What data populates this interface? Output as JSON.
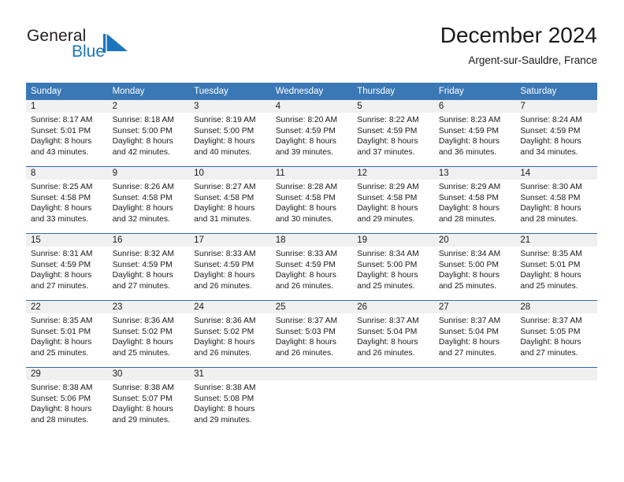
{
  "brand": {
    "name_part1": "General",
    "name_part2": "Blue",
    "flag_color": "#1b75bb"
  },
  "header": {
    "title": "December 2024",
    "subtitle": "Argent-sur-Sauldre, France"
  },
  "theme": {
    "header_blue": "#3a78b5",
    "rule_blue": "#2f6daf",
    "daynum_band": "#f0f0f0",
    "text": "#1a1a1a"
  },
  "weekdays": [
    "Sunday",
    "Monday",
    "Tuesday",
    "Wednesday",
    "Thursday",
    "Friday",
    "Saturday"
  ],
  "weeks": [
    [
      {
        "day": "1",
        "sunrise": "Sunrise: 8:17 AM",
        "sunset": "Sunset: 5:01 PM",
        "daylight1": "Daylight: 8 hours",
        "daylight2": "and 43 minutes."
      },
      {
        "day": "2",
        "sunrise": "Sunrise: 8:18 AM",
        "sunset": "Sunset: 5:00 PM",
        "daylight1": "Daylight: 8 hours",
        "daylight2": "and 42 minutes."
      },
      {
        "day": "3",
        "sunrise": "Sunrise: 8:19 AM",
        "sunset": "Sunset: 5:00 PM",
        "daylight1": "Daylight: 8 hours",
        "daylight2": "and 40 minutes."
      },
      {
        "day": "4",
        "sunrise": "Sunrise: 8:20 AM",
        "sunset": "Sunset: 4:59 PM",
        "daylight1": "Daylight: 8 hours",
        "daylight2": "and 39 minutes."
      },
      {
        "day": "5",
        "sunrise": "Sunrise: 8:22 AM",
        "sunset": "Sunset: 4:59 PM",
        "daylight1": "Daylight: 8 hours",
        "daylight2": "and 37 minutes."
      },
      {
        "day": "6",
        "sunrise": "Sunrise: 8:23 AM",
        "sunset": "Sunset: 4:59 PM",
        "daylight1": "Daylight: 8 hours",
        "daylight2": "and 36 minutes."
      },
      {
        "day": "7",
        "sunrise": "Sunrise: 8:24 AM",
        "sunset": "Sunset: 4:59 PM",
        "daylight1": "Daylight: 8 hours",
        "daylight2": "and 34 minutes."
      }
    ],
    [
      {
        "day": "8",
        "sunrise": "Sunrise: 8:25 AM",
        "sunset": "Sunset: 4:58 PM",
        "daylight1": "Daylight: 8 hours",
        "daylight2": "and 33 minutes."
      },
      {
        "day": "9",
        "sunrise": "Sunrise: 8:26 AM",
        "sunset": "Sunset: 4:58 PM",
        "daylight1": "Daylight: 8 hours",
        "daylight2": "and 32 minutes."
      },
      {
        "day": "10",
        "sunrise": "Sunrise: 8:27 AM",
        "sunset": "Sunset: 4:58 PM",
        "daylight1": "Daylight: 8 hours",
        "daylight2": "and 31 minutes."
      },
      {
        "day": "11",
        "sunrise": "Sunrise: 8:28 AM",
        "sunset": "Sunset: 4:58 PM",
        "daylight1": "Daylight: 8 hours",
        "daylight2": "and 30 minutes."
      },
      {
        "day": "12",
        "sunrise": "Sunrise: 8:29 AM",
        "sunset": "Sunset: 4:58 PM",
        "daylight1": "Daylight: 8 hours",
        "daylight2": "and 29 minutes."
      },
      {
        "day": "13",
        "sunrise": "Sunrise: 8:29 AM",
        "sunset": "Sunset: 4:58 PM",
        "daylight1": "Daylight: 8 hours",
        "daylight2": "and 28 minutes."
      },
      {
        "day": "14",
        "sunrise": "Sunrise: 8:30 AM",
        "sunset": "Sunset: 4:58 PM",
        "daylight1": "Daylight: 8 hours",
        "daylight2": "and 28 minutes."
      }
    ],
    [
      {
        "day": "15",
        "sunrise": "Sunrise: 8:31 AM",
        "sunset": "Sunset: 4:59 PM",
        "daylight1": "Daylight: 8 hours",
        "daylight2": "and 27 minutes."
      },
      {
        "day": "16",
        "sunrise": "Sunrise: 8:32 AM",
        "sunset": "Sunset: 4:59 PM",
        "daylight1": "Daylight: 8 hours",
        "daylight2": "and 27 minutes."
      },
      {
        "day": "17",
        "sunrise": "Sunrise: 8:33 AM",
        "sunset": "Sunset: 4:59 PM",
        "daylight1": "Daylight: 8 hours",
        "daylight2": "and 26 minutes."
      },
      {
        "day": "18",
        "sunrise": "Sunrise: 8:33 AM",
        "sunset": "Sunset: 4:59 PM",
        "daylight1": "Daylight: 8 hours",
        "daylight2": "and 26 minutes."
      },
      {
        "day": "19",
        "sunrise": "Sunrise: 8:34 AM",
        "sunset": "Sunset: 5:00 PM",
        "daylight1": "Daylight: 8 hours",
        "daylight2": "and 25 minutes."
      },
      {
        "day": "20",
        "sunrise": "Sunrise: 8:34 AM",
        "sunset": "Sunset: 5:00 PM",
        "daylight1": "Daylight: 8 hours",
        "daylight2": "and 25 minutes."
      },
      {
        "day": "21",
        "sunrise": "Sunrise: 8:35 AM",
        "sunset": "Sunset: 5:01 PM",
        "daylight1": "Daylight: 8 hours",
        "daylight2": "and 25 minutes."
      }
    ],
    [
      {
        "day": "22",
        "sunrise": "Sunrise: 8:35 AM",
        "sunset": "Sunset: 5:01 PM",
        "daylight1": "Daylight: 8 hours",
        "daylight2": "and 25 minutes."
      },
      {
        "day": "23",
        "sunrise": "Sunrise: 8:36 AM",
        "sunset": "Sunset: 5:02 PM",
        "daylight1": "Daylight: 8 hours",
        "daylight2": "and 25 minutes."
      },
      {
        "day": "24",
        "sunrise": "Sunrise: 8:36 AM",
        "sunset": "Sunset: 5:02 PM",
        "daylight1": "Daylight: 8 hours",
        "daylight2": "and 26 minutes."
      },
      {
        "day": "25",
        "sunrise": "Sunrise: 8:37 AM",
        "sunset": "Sunset: 5:03 PM",
        "daylight1": "Daylight: 8 hours",
        "daylight2": "and 26 minutes."
      },
      {
        "day": "26",
        "sunrise": "Sunrise: 8:37 AM",
        "sunset": "Sunset: 5:04 PM",
        "daylight1": "Daylight: 8 hours",
        "daylight2": "and 26 minutes."
      },
      {
        "day": "27",
        "sunrise": "Sunrise: 8:37 AM",
        "sunset": "Sunset: 5:04 PM",
        "daylight1": "Daylight: 8 hours",
        "daylight2": "and 27 minutes."
      },
      {
        "day": "28",
        "sunrise": "Sunrise: 8:37 AM",
        "sunset": "Sunset: 5:05 PM",
        "daylight1": "Daylight: 8 hours",
        "daylight2": "and 27 minutes."
      }
    ],
    [
      {
        "day": "29",
        "sunrise": "Sunrise: 8:38 AM",
        "sunset": "Sunset: 5:06 PM",
        "daylight1": "Daylight: 8 hours",
        "daylight2": "and 28 minutes."
      },
      {
        "day": "30",
        "sunrise": "Sunrise: 8:38 AM",
        "sunset": "Sunset: 5:07 PM",
        "daylight1": "Daylight: 8 hours",
        "daylight2": "and 29 minutes."
      },
      {
        "day": "31",
        "sunrise": "Sunrise: 8:38 AM",
        "sunset": "Sunset: 5:08 PM",
        "daylight1": "Daylight: 8 hours",
        "daylight2": "and 29 minutes."
      },
      {
        "day": "",
        "sunrise": "",
        "sunset": "",
        "daylight1": "",
        "daylight2": ""
      },
      {
        "day": "",
        "sunrise": "",
        "sunset": "",
        "daylight1": "",
        "daylight2": ""
      },
      {
        "day": "",
        "sunrise": "",
        "sunset": "",
        "daylight1": "",
        "daylight2": ""
      },
      {
        "day": "",
        "sunrise": "",
        "sunset": "",
        "daylight1": "",
        "daylight2": ""
      }
    ]
  ]
}
